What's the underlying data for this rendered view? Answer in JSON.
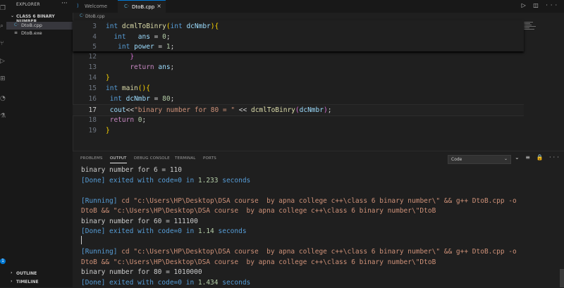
{
  "activity_icons": [
    "files-icon",
    "search-icon",
    "source-control-icon",
    "run-debug-icon",
    "extensions-icon",
    "remote-icon",
    "testing-icon"
  ],
  "sidebar": {
    "title": "EXPLORER",
    "more": "···",
    "folder": "CLASS 6 BINARY NUMBER",
    "files": [
      {
        "name": "DtoB.cpp",
        "icon": "C·"
      },
      {
        "name": "DtoB.exe",
        "icon": "≡"
      }
    ],
    "outline": "OUTLINE",
    "timeline": "TIMELINE",
    "badge": "1"
  },
  "tabs": [
    {
      "label": "Welcome",
      "active": false
    },
    {
      "label": "DtoB.cpp",
      "active": true
    }
  ],
  "tab_close": "×",
  "tab_actions": "▷ ◫ ···",
  "breadcrumb": "DtoB.cpp",
  "editor": {
    "sticky_lines": [
      {
        "num": "3",
        "tokens": [
          [
            "k",
            "int "
          ],
          [
            "fn",
            "dcmlToBinry"
          ],
          [
            "b1",
            "("
          ],
          [
            "k",
            "int "
          ],
          [
            "v",
            "dcNmbr"
          ],
          [
            "b1",
            ")"
          ],
          [
            "b1",
            "{"
          ]
        ]
      },
      {
        "num": "4",
        "tokens": [
          [
            "p",
            "  "
          ],
          [
            "k",
            "int "
          ],
          [
            "v",
            "  ans "
          ],
          [
            "p",
            "= "
          ],
          [
            "n",
            "0"
          ],
          [
            "p",
            ";"
          ]
        ]
      },
      {
        "num": "5",
        "tokens": [
          [
            "p",
            "   "
          ],
          [
            "k",
            "int "
          ],
          [
            "v",
            "power "
          ],
          [
            "p",
            "= "
          ],
          [
            "n",
            "1"
          ],
          [
            "p",
            ";"
          ]
        ]
      }
    ],
    "lines": [
      {
        "num": "12",
        "tokens": [
          [
            "p",
            "      "
          ],
          [
            "b2",
            "}"
          ]
        ]
      },
      {
        "num": "13",
        "tokens": [
          [
            "p",
            "      "
          ],
          [
            "k2",
            "return "
          ],
          [
            "v",
            "ans"
          ],
          [
            "p",
            ";"
          ]
        ]
      },
      {
        "num": "14",
        "tokens": [
          [
            "b1",
            "}"
          ]
        ]
      },
      {
        "num": "15",
        "tokens": [
          [
            "k",
            "int "
          ],
          [
            "fn",
            "main"
          ],
          [
            "b1",
            "()"
          ],
          [
            "b1",
            "{"
          ]
        ]
      },
      {
        "num": "16",
        "tokens": [
          [
            "p",
            " "
          ],
          [
            "k",
            "int "
          ],
          [
            "v",
            "dcNmbr "
          ],
          [
            "p",
            "= "
          ],
          [
            "n",
            "80"
          ],
          [
            "p",
            ";"
          ]
        ]
      },
      {
        "num": "17",
        "tokens": [
          [
            "p",
            " "
          ],
          [
            "v",
            "cout"
          ],
          [
            "p",
            "<<"
          ],
          [
            "s",
            "\"binary number for 80 = \""
          ],
          [
            "p",
            " << "
          ],
          [
            "fn",
            "dcmlToBinry"
          ],
          [
            "b2",
            "("
          ],
          [
            "v",
            "dcNmbr"
          ],
          [
            "b2",
            ")"
          ],
          [
            "p",
            ";"
          ]
        ],
        "current": true
      },
      {
        "num": "18",
        "tokens": [
          [
            "p",
            " "
          ],
          [
            "k2",
            "return "
          ],
          [
            "n",
            "0"
          ],
          [
            "p",
            ";"
          ]
        ]
      },
      {
        "num": "19",
        "tokens": [
          [
            "b1",
            "}"
          ]
        ]
      }
    ]
  },
  "panel": {
    "tabs": [
      "PROBLEMS",
      "OUTPUT",
      "DEBUG CONSOLE",
      "TERMINAL",
      "PORTS"
    ],
    "active_tab": "OUTPUT",
    "channel": "Code",
    "actions": "⌄ ≡ 🔒 ··· ⌃ ×",
    "output": [
      [
        [
          "o-white",
          "binary number for 6 = 110"
        ]
      ],
      [
        [
          "o-blue",
          "[Done] exited with "
        ],
        [
          "o-blue",
          "code=0"
        ],
        [
          "o-blue",
          " in "
        ],
        [
          "o-num",
          "1.233"
        ],
        [
          "o-blue",
          " seconds"
        ]
      ],
      [],
      [
        [
          "o-blue",
          "[Running] "
        ],
        [
          "o-orange",
          "cd \"c:\\Users\\HP\\Desktop\\DSA course  by apna college c++\\class 6 binary number\\\" && g++ DtoB.cpp -o"
        ]
      ],
      [
        [
          "o-orange",
          "DtoB && \"c:\\Users\\HP\\Desktop\\DSA course  by apna college c++\\class 6 binary number\\\"DtoB"
        ]
      ],
      [
        [
          "o-white",
          "binary number for 60 = 111100"
        ]
      ],
      [
        [
          "o-blue",
          "[Done] exited with "
        ],
        [
          "o-blue",
          "code=0"
        ],
        [
          "o-blue",
          " in "
        ],
        [
          "o-num",
          "1.14"
        ],
        [
          "o-blue",
          " seconds"
        ]
      ],
      [],
      [
        [
          "o-blue",
          "[Running] "
        ],
        [
          "o-orange",
          "cd \"c:\\Users\\HP\\Desktop\\DSA course  by apna college c++\\class 6 binary number\\\" && g++ DtoB.cpp -o"
        ]
      ],
      [
        [
          "o-orange",
          "DtoB && \"c:\\Users\\HP\\Desktop\\DSA course  by apna college c++\\class 6 binary number\\\"DtoB"
        ]
      ],
      [
        [
          "o-white",
          "binary number for 80 = 1010000"
        ]
      ],
      [
        [
          "o-blue",
          "[Done] exited with "
        ],
        [
          "o-blue",
          "code=0"
        ],
        [
          "o-blue",
          " in "
        ],
        [
          "o-num",
          "1.434"
        ],
        [
          "o-blue",
          " seconds"
        ]
      ]
    ]
  }
}
